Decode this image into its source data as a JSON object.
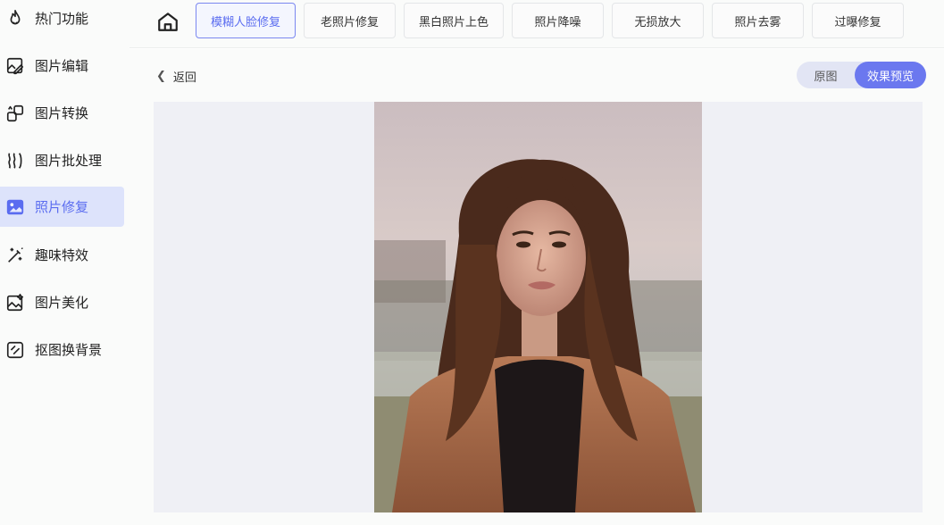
{
  "sidebar": {
    "items": [
      {
        "label": "热门功能",
        "icon": "flame-icon",
        "active": false
      },
      {
        "label": "图片编辑",
        "icon": "image-edit-icon",
        "active": false
      },
      {
        "label": "图片转换",
        "icon": "image-convert-icon",
        "active": false
      },
      {
        "label": "图片批处理",
        "icon": "batch-process-icon",
        "active": false
      },
      {
        "label": "照片修复",
        "icon": "photo-repair-icon",
        "active": true
      },
      {
        "label": "趣味特效",
        "icon": "magic-wand-icon",
        "active": false
      },
      {
        "label": "图片美化",
        "icon": "image-beautify-icon",
        "active": false
      },
      {
        "label": "抠图换背景",
        "icon": "cutout-icon",
        "active": false
      }
    ]
  },
  "topbar": {
    "home_icon": "home-icon",
    "tabs": [
      {
        "label": "模糊人脸修复",
        "active": true
      },
      {
        "label": "老照片修复",
        "active": false
      },
      {
        "label": "黑白照片上色",
        "active": false
      },
      {
        "label": "照片降噪",
        "active": false
      },
      {
        "label": "无损放大",
        "active": false
      },
      {
        "label": "照片去雾",
        "active": false
      },
      {
        "label": "过曝修复",
        "active": false
      }
    ]
  },
  "main": {
    "back_label": "返回",
    "toggle": {
      "original_label": "原图",
      "preview_label": "效果预览",
      "selected": "效果预览"
    }
  },
  "colors": {
    "accent": "#6b78ef",
    "active_bg": "#dde3fb",
    "stage_bg": "#eff0f5"
  }
}
